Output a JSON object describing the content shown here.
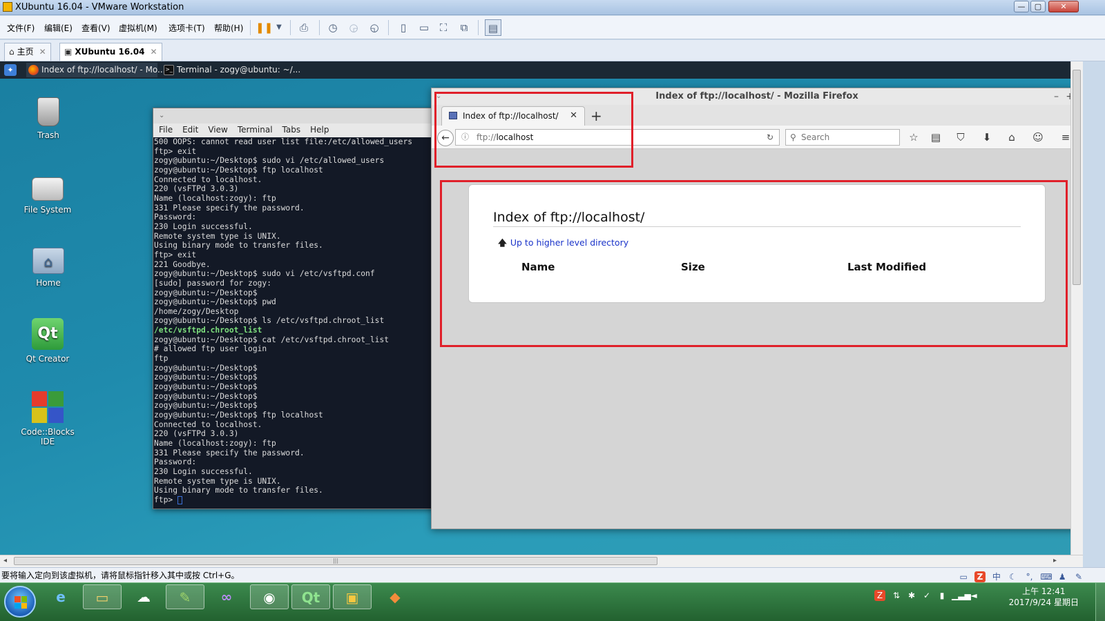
{
  "vmware": {
    "title": "XUbuntu 16.04 - VMware Workstation",
    "window_buttons": {
      "minimize": "—",
      "restore": "▢",
      "close": "✕"
    },
    "menus": [
      "文件(F)",
      "编辑(E)",
      "查看(V)",
      "虚拟机(M)",
      "选项卡(T)",
      "帮助(H)"
    ],
    "tabs": [
      {
        "label": "主页",
        "icon": "home-icon",
        "close": "✕"
      },
      {
        "label": "XUbuntu 16.04",
        "icon": "vm-icon",
        "close": "✕"
      }
    ],
    "status_text": "要将输入定向到该虚拟机，请将鼠标指针移入其中或按 Ctrl+G。"
  },
  "xfce": {
    "panel_tasks": [
      {
        "label": "Index of ftp://localhost/ - Mo...",
        "icon": "firefox-icon"
      },
      {
        "label": "Terminal - zogy@ubuntu: ~/...",
        "icon": "terminal-icon"
      }
    ],
    "desktop_icons": [
      {
        "label": "Trash",
        "icon": "trash-icon"
      },
      {
        "label": "File System",
        "icon": "drive-icon"
      },
      {
        "label": "Home",
        "icon": "home-folder-icon"
      },
      {
        "label": "Qt Creator",
        "icon": "qt-creator-icon"
      },
      {
        "label": "Code::Blocks IDE",
        "icon": "codeblocks-icon"
      }
    ]
  },
  "terminal": {
    "menu": [
      "File",
      "Edit",
      "View",
      "Terminal",
      "Tabs",
      "Help"
    ],
    "lines": [
      "500 OOPS: cannot read user list file:/etc/allowed_users",
      "ftp> exit",
      "zogy@ubuntu:~/Desktop$ sudo vi /etc/allowed_users",
      "zogy@ubuntu:~/Desktop$ ftp localhost",
      "Connected to localhost.",
      "220 (vsFTPd 3.0.3)",
      "Name (localhost:zogy): ftp",
      "331 Please specify the password.",
      "Password:",
      "230 Login successful.",
      "Remote system type is UNIX.",
      "Using binary mode to transfer files.",
      "ftp> exit",
      "221 Goodbye.",
      "zogy@ubuntu:~/Desktop$ sudo vi /etc/vsftpd.conf",
      "[sudo] password for zogy:",
      "zogy@ubuntu:~/Desktop$",
      "zogy@ubuntu:~/Desktop$ pwd",
      "/home/zogy/Desktop",
      "zogy@ubuntu:~/Desktop$ ls /etc/vsftpd.chroot_list",
      "/etc/vsftpd.chroot_list",
      "zogy@ubuntu:~/Desktop$ cat /etc/vsftpd.chroot_list",
      "# allowed ftp user login",
      "ftp",
      "zogy@ubuntu:~/Desktop$",
      "zogy@ubuntu:~/Desktop$",
      "zogy@ubuntu:~/Desktop$",
      "zogy@ubuntu:~/Desktop$",
      "zogy@ubuntu:~/Desktop$",
      "zogy@ubuntu:~/Desktop$ ftp localhost",
      "Connected to localhost.",
      "220 (vsFTPd 3.0.3)",
      "Name (localhost:zogy): ftp",
      "331 Please specify the password.",
      "Password:",
      "230 Login successful.",
      "Remote system type is UNIX.",
      "Using binary mode to transfer files.",
      "ftp> "
    ],
    "highlight_line_index": 20
  },
  "firefox": {
    "window_title": "Index of ftp://localhost/ - Mozilla Firefox",
    "tab_title": "Index of ftp://localhost/",
    "url_scheme": "ftp://",
    "url_host": "localhost",
    "search_placeholder": "Search",
    "page": {
      "heading": "Index of ftp://localhost/",
      "up_link": "Up to higher level directory",
      "columns": [
        "Name",
        "Size",
        "Last Modified"
      ]
    }
  },
  "taskbar": {
    "clock_time": "上午 12:41",
    "clock_date": "2017/9/24 星期日",
    "ime_label": "中"
  },
  "colors": {
    "highlight": "#e0202a",
    "link": "#1a33c9",
    "terminal_bg": "#131926"
  }
}
